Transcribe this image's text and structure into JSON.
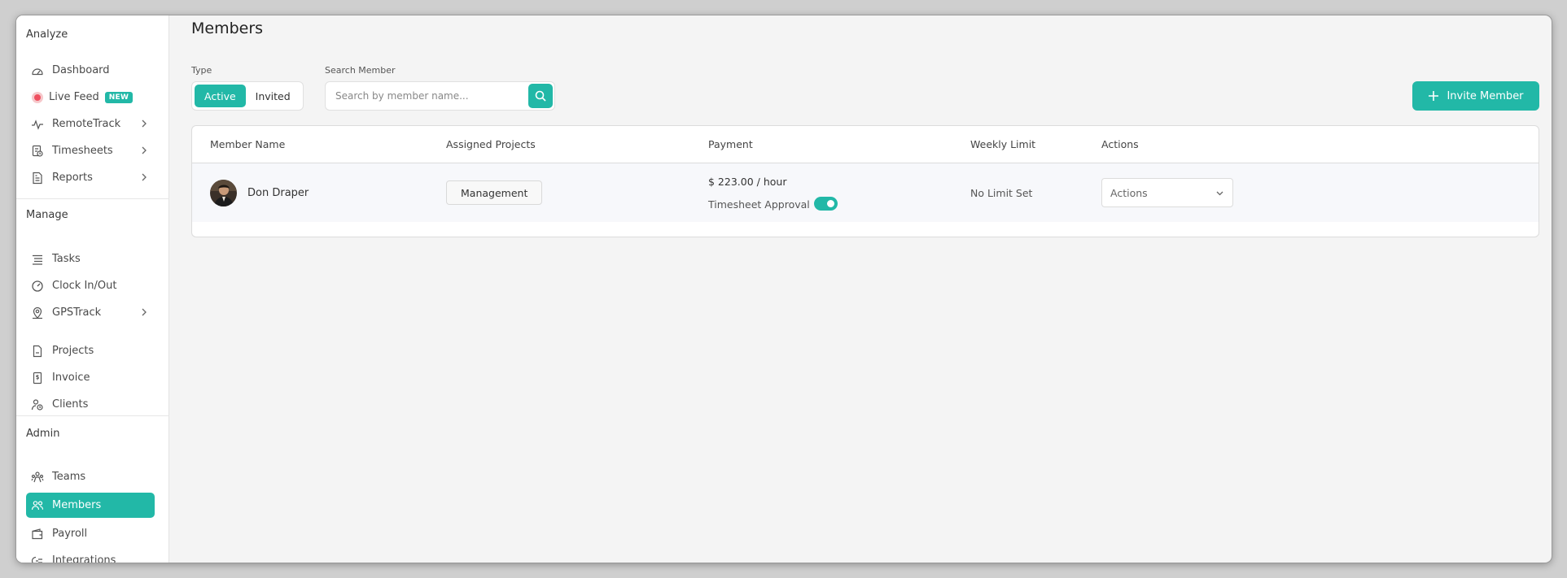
{
  "sidebar": {
    "sections": {
      "analyze": "Analyze",
      "manage": "Manage",
      "admin": "Admin"
    },
    "items": {
      "dashboard": "Dashboard",
      "live_feed": "Live Feed",
      "live_feed_badge": "NEW",
      "remotetrack": "RemoteTrack",
      "timesheets": "Timesheets",
      "reports": "Reports",
      "tasks": "Tasks",
      "clock": "Clock In/Out",
      "gpstrack": "GPSTrack",
      "projects": "Projects",
      "invoice": "Invoice",
      "clients": "Clients",
      "teams": "Teams",
      "members": "Members",
      "payroll": "Payroll",
      "integrations": "Integrations"
    },
    "active_item": "members"
  },
  "page": {
    "title": "Members"
  },
  "filters": {
    "type_label": "Type",
    "type_options": [
      "Active",
      "Invited"
    ],
    "type_selected": "Active",
    "search_label": "Search Member",
    "search_placeholder": "Search by member name...",
    "search_value": ""
  },
  "invite_button": "Invite Member",
  "table": {
    "headers": {
      "name": "Member Name",
      "projects": "Assigned Projects",
      "payment": "Payment",
      "weekly": "Weekly Limit",
      "actions": "Actions"
    },
    "rows": [
      {
        "name": "Don Draper",
        "project": "Management",
        "payment": "$ 223.00 / hour",
        "timesheet_label": "Timesheet Approval",
        "timesheet_approval": true,
        "weekly_limit": "No Limit Set",
        "actions": "Actions"
      }
    ]
  },
  "colors": {
    "accent": "#22b8a7",
    "live_dot": "#ef5060"
  }
}
